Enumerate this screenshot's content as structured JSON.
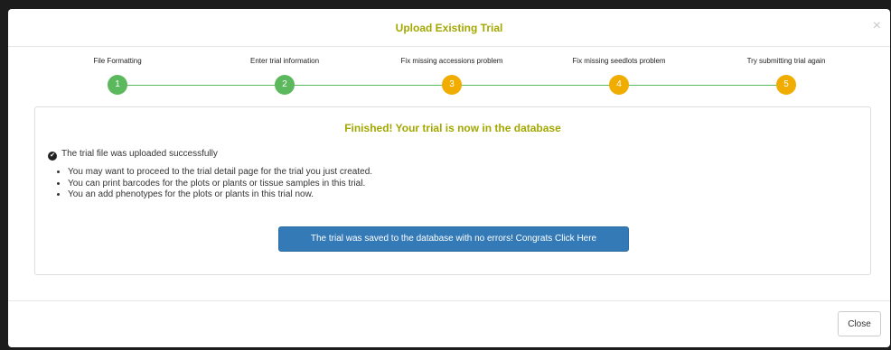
{
  "modal": {
    "title": "Upload Existing Trial",
    "close_symbol": "×",
    "close_button_label": "Close"
  },
  "colors": {
    "completed": "#5cb85c",
    "pending": "#f0ad00",
    "title": "#a3a800",
    "primary_button": "#337ab7"
  },
  "steps": [
    {
      "label": "File Formatting",
      "number": "1",
      "status": "completed"
    },
    {
      "label": "Enter trial information",
      "number": "2",
      "status": "completed"
    },
    {
      "label": "Fix missing accessions problem",
      "number": "3",
      "status": "pending"
    },
    {
      "label": "Fix missing seedlots problem",
      "number": "4",
      "status": "pending"
    },
    {
      "label": "Try submitting trial again",
      "number": "5",
      "status": "pending"
    }
  ],
  "panel": {
    "heading": "Finished! Your trial is now in the database",
    "success_message": "The trial file was uploaded successfully",
    "check_icon": "check-circle-icon",
    "bullets": [
      "You may want to proceed to the trial detail page for the trial you just created.",
      "You can print barcodes for the plots or plants or tissue samples in this trial.",
      "You an add phenotypes for the plots or plants in this trial now."
    ],
    "button_label": "The trial was saved to the database with no errors! Congrats Click Here"
  }
}
